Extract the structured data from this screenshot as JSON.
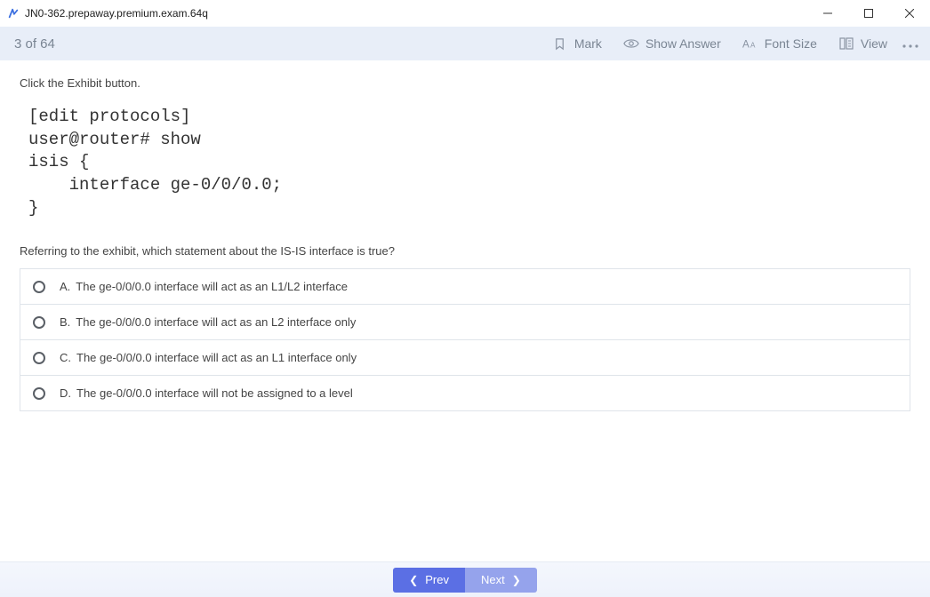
{
  "window": {
    "title": "JN0-362.prepaway.premium.exam.64q"
  },
  "toolbar": {
    "counter": "3 of 64",
    "mark": "Mark",
    "show_answer": "Show Answer",
    "font_size": "Font Size",
    "view": "View"
  },
  "question": {
    "instruction": "Click the Exhibit button.",
    "exhibit": "[edit protocols]\nuser@router# show\nisis {\n    interface ge-0/0/0.0;\n}",
    "text": "Referring to the exhibit, which statement about the IS-IS interface is true?",
    "options": [
      {
        "letter": "A.",
        "text": "The ge-0/0/0.0 interface will act as an L1/L2 interface"
      },
      {
        "letter": "B.",
        "text": "The ge-0/0/0.0 interface will act as an L2 interface only"
      },
      {
        "letter": "C.",
        "text": "The ge-0/0/0.0 interface will act as an L1 interface only"
      },
      {
        "letter": "D.",
        "text": "The ge-0/0/0.0 interface will not be assigned to a level"
      }
    ]
  },
  "footer": {
    "prev": "Prev",
    "next": "Next"
  }
}
